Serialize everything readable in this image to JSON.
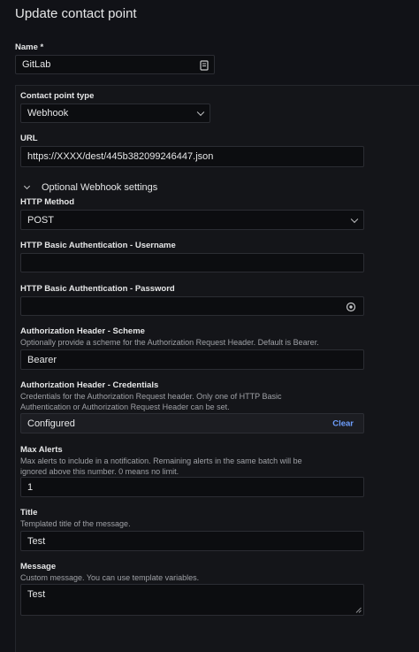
{
  "header": {
    "title": "Update contact point"
  },
  "name": {
    "label": "Name *",
    "value": "GitLab"
  },
  "contact_point_type": {
    "label": "Contact point type",
    "value": "Webhook"
  },
  "url": {
    "label": "URL",
    "value": "https://XXXX/dest/445b382099246447.json"
  },
  "optional_settings": {
    "label": "Optional Webhook settings"
  },
  "http_method": {
    "label": "HTTP Method",
    "value": "POST"
  },
  "basic_auth_username": {
    "label": "HTTP Basic Authentication - Username",
    "value": ""
  },
  "basic_auth_password": {
    "label": "HTTP Basic Authentication - Password",
    "value": ""
  },
  "auth_scheme": {
    "label": "Authorization Header - Scheme",
    "description": "Optionally provide a scheme for the Authorization Request Header. Default is Bearer.",
    "value": "Bearer"
  },
  "auth_credentials": {
    "label": "Authorization Header - Credentials",
    "description_line1": "Credentials for the Authorization Request header. Only one of HTTP Basic",
    "description_line2": "Authentication or Authorization Request Header can be set.",
    "value": "Configured",
    "clear_label": "Clear"
  },
  "max_alerts": {
    "label": "Max Alerts",
    "description_line1": "Max alerts to include in a notification. Remaining alerts in the same batch will be",
    "description_line2": "ignored above this number. 0 means no limit.",
    "value": "1"
  },
  "title_field": {
    "label": "Title",
    "description": "Templated title of the message.",
    "value": "Test"
  },
  "message_field": {
    "label": "Message",
    "description": "Custom message. You can use template variables.",
    "value": "Test"
  }
}
